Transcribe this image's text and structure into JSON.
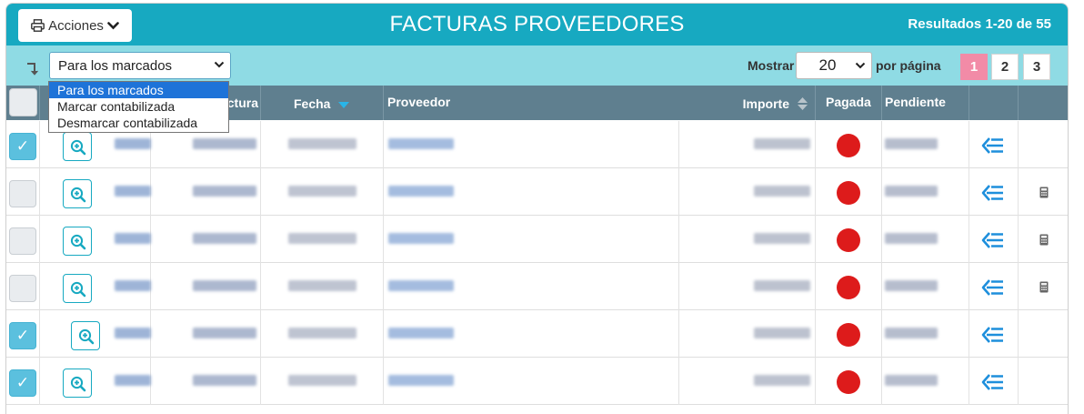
{
  "header": {
    "actions_label": "Acciones",
    "title": "FACTURAS PROVEEDORES",
    "results": "Resultados 1-20 de 55"
  },
  "toolbar": {
    "bulk_select_value": "Para los marcados",
    "show_label": "Mostrar",
    "per_page_value": "20",
    "per_page_suffix": "por página",
    "pages": [
      "1",
      "2",
      "3"
    ],
    "active_page": "1"
  },
  "dropdown": {
    "options": [
      "Para los marcados",
      "Marcar contabilizada",
      "Desmarcar contabilizada"
    ],
    "selected": "Para los marcados"
  },
  "table": {
    "columns": {
      "factura": "Factura",
      "fecha": "Fecha",
      "proveedor": "Proveedor",
      "importe": "Importe",
      "pagada": "Pagada",
      "pendiente": "Pendiente"
    },
    "rows": [
      {
        "checked": true,
        "paid": false,
        "has_calc": false
      },
      {
        "checked": false,
        "paid": false,
        "has_calc": true
      },
      {
        "checked": false,
        "paid": false,
        "has_calc": true
      },
      {
        "checked": false,
        "paid": false,
        "has_calc": true
      },
      {
        "checked": true,
        "paid": false,
        "has_calc": false
      },
      {
        "checked": true,
        "paid": false,
        "has_calc": false
      }
    ]
  },
  "colors": {
    "header": "#17a9c1",
    "toolbar": "#8fdbe4",
    "table_head": "#5f7f8f",
    "active_page": "#f28ba7",
    "checkbox_on": "#5bc0de",
    "unpaid_dot": "#dd1b1b",
    "accent_blue": "#1e8fdc"
  },
  "icons": {
    "actions": "printer-icon",
    "caret": "chevron-down-icon",
    "row_zoom": "zoom-in-icon",
    "row_action": "list-arrow-left-icon",
    "row_extra": "calculator-icon",
    "toolbar_arrow": "arrow-turn-down-icon",
    "sort": "sort-icon"
  }
}
